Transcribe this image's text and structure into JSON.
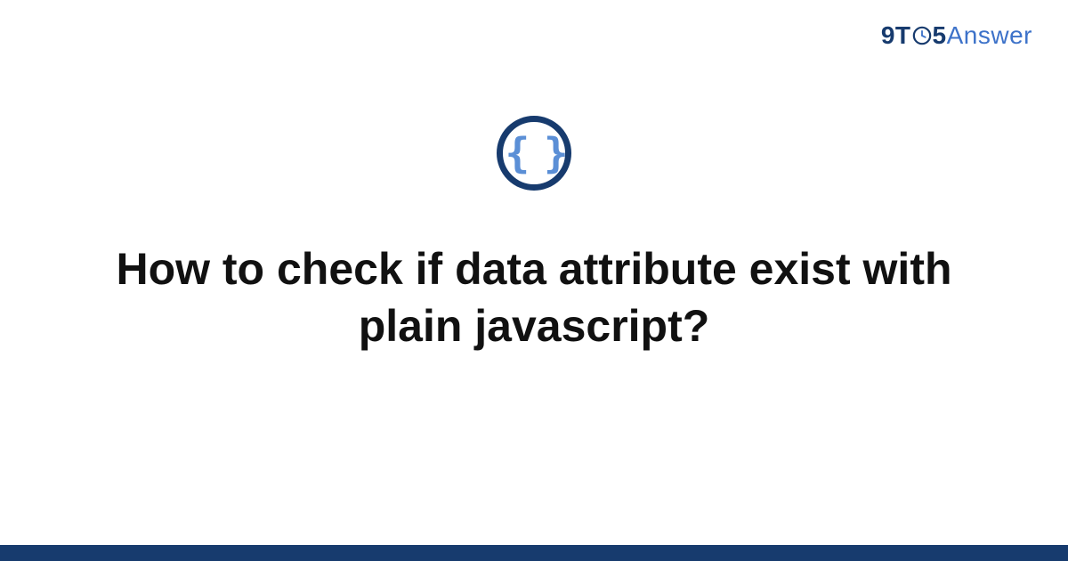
{
  "logo": {
    "part1": "9T",
    "part2": "5",
    "part3": "Answer"
  },
  "badge": {
    "icon_name": "code-braces-icon",
    "glyph": "{ }"
  },
  "headline": "How to check if data attribute exist with plain javascript?",
  "colors": {
    "brand_dark": "#173b6e",
    "brand_light": "#3d72c9",
    "brace_blue": "#5b8fd6"
  }
}
